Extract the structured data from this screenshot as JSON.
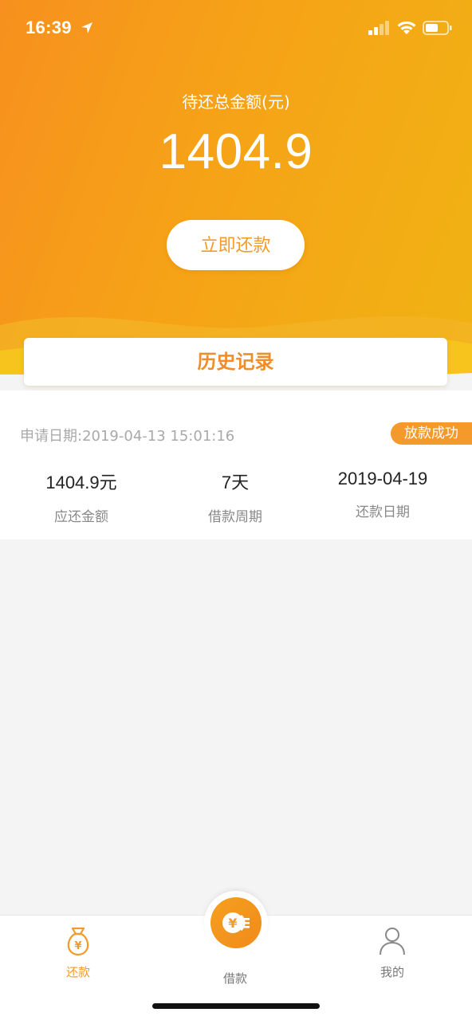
{
  "status_bar": {
    "time": "16:39"
  },
  "summary": {
    "label": "待还总金额(元)",
    "amount": "1404.9",
    "repay_button": "立即还款"
  },
  "history": {
    "title": "历史记录"
  },
  "record": {
    "apply_date": "申请日期:2019-04-13 15:01:16",
    "status": "放款成功",
    "stats": [
      {
        "value": "1404.9元",
        "label": "应还金额"
      },
      {
        "value": "7天",
        "label": "借款周期"
      },
      {
        "value": "2019-04-19",
        "label": "还款日期"
      }
    ]
  },
  "tabbar": {
    "items": [
      {
        "label": "还款",
        "icon": "money-bag-icon",
        "active": true
      },
      {
        "label": "借款",
        "icon": "coin-icon",
        "active": false
      },
      {
        "label": "我的",
        "icon": "person-icon",
        "active": false
      }
    ]
  },
  "colors": {
    "accent": "#f39a2a",
    "hero_start": "#f7901e",
    "hero_end": "#f0b313"
  }
}
